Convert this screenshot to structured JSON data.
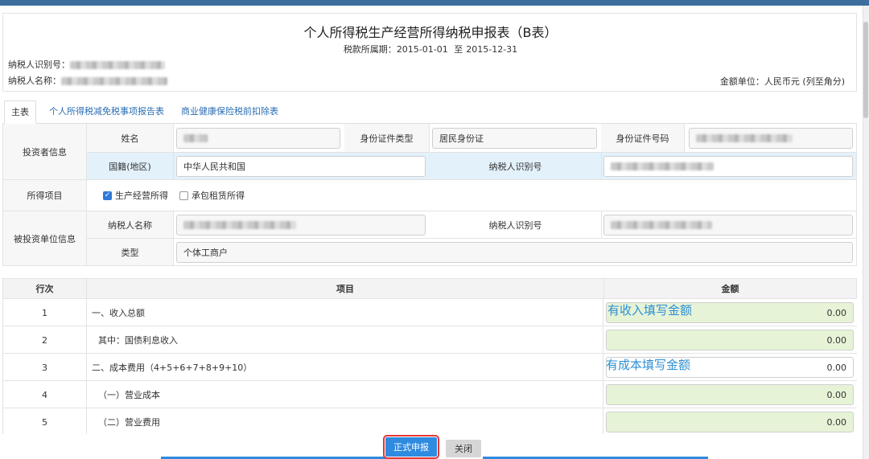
{
  "header": {
    "title": "个人所得税生产经营所得纳税申报表（B表）",
    "period_label": "税款所属期：",
    "period_start": "2015-01-01",
    "period_to": "至",
    "period_end": "2015-12-31",
    "taxpayer_id_label": "纳税人识别号：",
    "taxpayer_name_label": "纳税人名称：",
    "unit": "金额单位：人民币元 (列至角分)"
  },
  "tabs": [
    {
      "label": "主表",
      "active": true
    },
    {
      "label": "个人所得税减免税事项报告表",
      "active": false
    },
    {
      "label": "商业健康保险税前扣除表",
      "active": false
    }
  ],
  "investor": {
    "section_label": "投资者信息",
    "name_label": "姓名",
    "id_type_label": "身份证件类型",
    "id_type_value": "居民身份证",
    "id_number_label": "身份证件号码",
    "nationality_label": "国籍(地区)",
    "nationality_value": "中华人民共和国",
    "taxpayer_id_label": "纳税人识别号"
  },
  "income_item": {
    "section_label": "所得项目",
    "options": [
      {
        "label": "生产经营所得",
        "checked": true
      },
      {
        "label": "承包租赁所得",
        "checked": false
      }
    ]
  },
  "invested_unit": {
    "section_label": "被投资单位信息",
    "name_label": "纳税人名称",
    "taxpayer_id_label": "纳税人识别号",
    "type_label": "类型",
    "type_value": "个体工商户"
  },
  "table": {
    "headers": [
      "行次",
      "项目",
      "金额"
    ],
    "rows": [
      {
        "no": "1",
        "item": "一、收入总额",
        "amount": "0.00",
        "hint": "有收入填写金额",
        "green": true
      },
      {
        "no": "2",
        "item": "其中：国债利息收入",
        "amount": "0.00",
        "hint": "",
        "green": true
      },
      {
        "no": "3",
        "item": "二、成本费用（4+5+6+7+8+9+10）",
        "amount": "0.00",
        "hint": "有成本填写金额",
        "green": false
      },
      {
        "no": "4",
        "item": "（一）营业成本",
        "amount": "0.00",
        "hint": "",
        "green": true
      },
      {
        "no": "5",
        "item": "（二）营业费用",
        "amount": "0.00",
        "hint": "",
        "green": true
      }
    ]
  },
  "buttons": {
    "submit": "正式申报",
    "close": "关闭"
  },
  "colors": {
    "accent": "#2f8be0",
    "highlight_box": "#e53535",
    "hint_text": "#2d8fd5",
    "amount_field": "#e6f3d6"
  }
}
